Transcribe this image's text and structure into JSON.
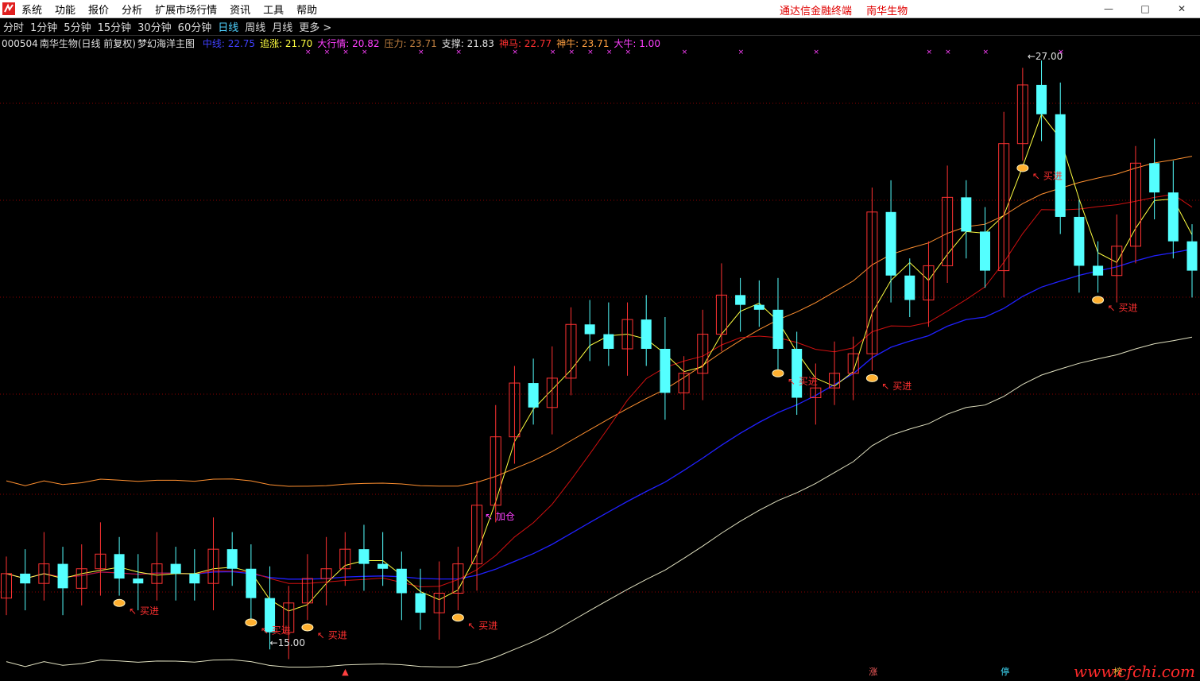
{
  "menu": {
    "items": [
      "系统",
      "功能",
      "报价",
      "分析",
      "扩展市场行情",
      "资讯",
      "工具",
      "帮助"
    ],
    "brand": [
      "通达信金融终端",
      "南华生物"
    ]
  },
  "periods": {
    "items": [
      "分时",
      "1分钟",
      "5分钟",
      "15分钟",
      "30分钟",
      "60分钟",
      "日线",
      "周线",
      "月线",
      "更多 >"
    ],
    "active_index": 6
  },
  "indicator": {
    "code": "000504",
    "name": "南华生物(日线 前复权)",
    "formula": "梦幻海洋主图",
    "values": [
      {
        "label": "中线",
        "value": "22.75",
        "color": "#4040ff"
      },
      {
        "label": "追涨",
        "value": "21.70",
        "color": "#ffff40"
      },
      {
        "label": "大行情",
        "value": "20.82",
        "color": "#ff40ff"
      },
      {
        "label": "压力",
        "value": "23.71",
        "color": "#c08040"
      },
      {
        "label": "支撑",
        "value": "21.83",
        "color": "#e0e0e0"
      },
      {
        "label": "神马",
        "value": "22.77",
        "color": "#ff3030"
      },
      {
        "label": "神牛",
        "value": "23.71",
        "color": "#ffa040"
      },
      {
        "label": "大牛",
        "value": "1.00",
        "color": "#ff40ff"
      }
    ]
  },
  "annotations": {
    "high": "27.00",
    "low": "15.00",
    "buy_labels": [
      "买进",
      "买进",
      "买进",
      "买进",
      "买进",
      "买进",
      "买进"
    ],
    "add_label": "加仓"
  },
  "footer": {
    "markers": [
      {
        "text": "▲",
        "color": "#ff4040"
      },
      {
        "text": "涨",
        "color": "#ff6060"
      },
      {
        "text": "停",
        "color": "#40e0ff"
      },
      {
        "text": "榜",
        "color": "#ffc040"
      }
    ],
    "watermark": "www.cfchi.com"
  },
  "colors": {
    "up": "#ff3232",
    "down": "#54ffff",
    "grid": "#8b0000",
    "ma_yellow": "#ffff40",
    "ma_red": "#d01010",
    "ma_blue": "#2020ff",
    "band_upper": "#ff9030",
    "band_lower": "#e0e0c0"
  },
  "chart_data": {
    "type": "candlestick",
    "symbol": "000504",
    "price_high": 27.0,
    "price_low": 15.0,
    "candles": [
      {
        "o": 15.9,
        "c": 16.4
      },
      {
        "o": 16.4,
        "c": 16.2
      },
      {
        "o": 16.2,
        "c": 16.6
      },
      {
        "o": 16.6,
        "c": 16.1
      },
      {
        "o": 16.1,
        "c": 16.5
      },
      {
        "o": 16.5,
        "c": 16.8
      },
      {
        "o": 16.8,
        "c": 16.3
      },
      {
        "o": 16.3,
        "c": 16.2
      },
      {
        "o": 16.2,
        "c": 16.6
      },
      {
        "o": 16.6,
        "c": 16.4
      },
      {
        "o": 16.4,
        "c": 16.2
      },
      {
        "o": 16.2,
        "c": 16.9
      },
      {
        "o": 16.9,
        "c": 16.5
      },
      {
        "o": 16.5,
        "c": 15.9
      },
      {
        "o": 15.9,
        "c": 15.2
      },
      {
        "o": 15.2,
        "c": 15.8
      },
      {
        "o": 15.8,
        "c": 16.3
      },
      {
        "o": 16.3,
        "c": 16.5
      },
      {
        "o": 16.5,
        "c": 16.9
      },
      {
        "o": 16.9,
        "c": 16.6
      },
      {
        "o": 16.6,
        "c": 16.5
      },
      {
        "o": 16.5,
        "c": 16.0
      },
      {
        "o": 16.0,
        "c": 15.6
      },
      {
        "o": 15.6,
        "c": 16.0
      },
      {
        "o": 16.0,
        "c": 16.6
      },
      {
        "o": 16.6,
        "c": 17.8
      },
      {
        "o": 17.8,
        "c": 19.2
      },
      {
        "o": 19.2,
        "c": 20.3
      },
      {
        "o": 20.3,
        "c": 19.8
      },
      {
        "o": 19.8,
        "c": 20.4
      },
      {
        "o": 20.4,
        "c": 21.5
      },
      {
        "o": 21.5,
        "c": 21.3
      },
      {
        "o": 21.3,
        "c": 21.0
      },
      {
        "o": 21.0,
        "c": 21.6
      },
      {
        "o": 21.6,
        "c": 21.0
      },
      {
        "o": 21.0,
        "c": 20.1
      },
      {
        "o": 20.1,
        "c": 20.5
      },
      {
        "o": 20.5,
        "c": 21.3
      },
      {
        "o": 21.3,
        "c": 22.1
      },
      {
        "o": 22.1,
        "c": 21.9
      },
      {
        "o": 21.9,
        "c": 21.8
      },
      {
        "o": 21.8,
        "c": 21.0
      },
      {
        "o": 21.0,
        "c": 20.0
      },
      {
        "o": 20.0,
        "c": 20.2
      },
      {
        "o": 20.2,
        "c": 20.5
      },
      {
        "o": 20.5,
        "c": 20.9
      },
      {
        "o": 20.9,
        "c": 23.8
      },
      {
        "o": 23.8,
        "c": 22.5
      },
      {
        "o": 22.5,
        "c": 22.0
      },
      {
        "o": 22.0,
        "c": 22.7
      },
      {
        "o": 22.7,
        "c": 24.1
      },
      {
        "o": 24.1,
        "c": 23.4
      },
      {
        "o": 23.4,
        "c": 22.6
      },
      {
        "o": 22.6,
        "c": 25.2
      },
      {
        "o": 25.2,
        "c": 26.4
      },
      {
        "o": 26.4,
        "c": 25.8
      },
      {
        "o": 25.8,
        "c": 23.7
      },
      {
        "o": 23.7,
        "c": 22.7
      },
      {
        "o": 22.7,
        "c": 22.5
      },
      {
        "o": 22.5,
        "c": 23.1
      },
      {
        "o": 23.1,
        "c": 24.8
      },
      {
        "o": 24.8,
        "c": 24.2
      },
      {
        "o": 24.2,
        "c": 23.2
      },
      {
        "o": 23.2,
        "c": 22.6
      }
    ]
  }
}
